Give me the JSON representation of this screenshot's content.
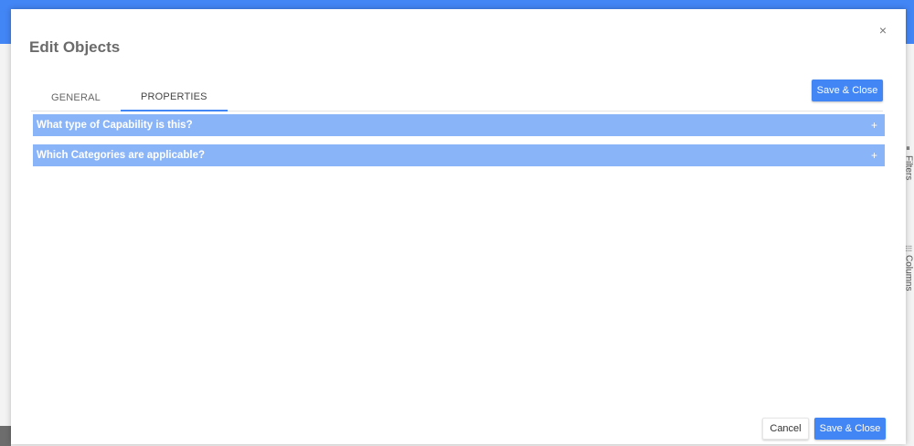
{
  "modal": {
    "title": "Edit Objects",
    "close_glyph": "×"
  },
  "tabs": [
    {
      "label": "GENERAL",
      "active": false
    },
    {
      "label": "PROPERTIES",
      "active": true
    }
  ],
  "toolbar": {
    "save_close_label": "Save & Close"
  },
  "sections": [
    {
      "label": "What type of Capability is this?",
      "toggle_glyph": "+"
    },
    {
      "label": "Which Categories are applicable?",
      "toggle_glyph": "+"
    }
  ],
  "footer": {
    "cancel_label": "Cancel",
    "save_close_label": "Save & Close"
  },
  "side_panel": {
    "filters_label": "Filters",
    "columns_label": "Columns",
    "filters_icon": "filter-icon",
    "columns_icon": "columns-icon"
  },
  "colors": {
    "accent": "#4285f4",
    "section_header": "#8ab4f8",
    "title_text": "#6b6b6b"
  }
}
